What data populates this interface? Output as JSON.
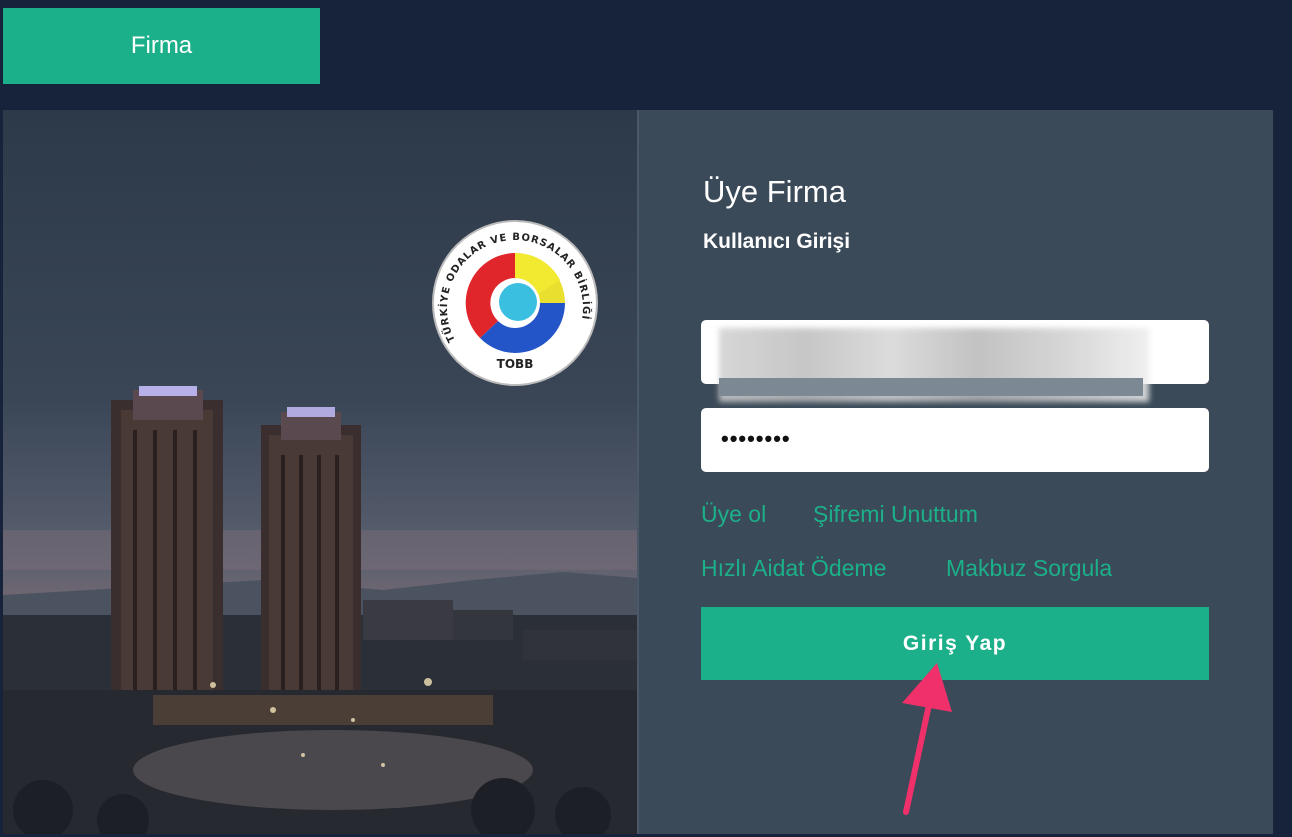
{
  "header": {
    "tab_label": "Firma"
  },
  "hero": {
    "logo_ring_text": "TÜRKİYE ODALAR VE BORSALAR BİRLİĞİ",
    "logo_bottom_text": "TOBB"
  },
  "login": {
    "title": "Üye Firma",
    "subtitle": "Kullanıcı Girişi",
    "username_value": "",
    "password_value": "••••••••",
    "links": {
      "register": "Üye ol",
      "forgot_password": "Şifremi Unuttum",
      "quick_payment": "Hızlı Aidat Ödeme",
      "receipt_query": "Makbuz Sorgula"
    },
    "submit_label": "Giriş Yap"
  },
  "colors": {
    "accent": "#1cb08a",
    "background": "#16233a",
    "panel": "#3b4a58",
    "annotation_arrow": "#f0306a"
  }
}
